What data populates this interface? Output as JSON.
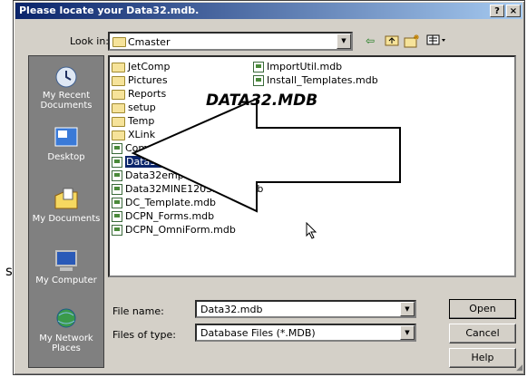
{
  "stray_text": "s",
  "dialog": {
    "title": "Please locate your Data32.mdb.",
    "help_button": "?",
    "close_button": "×"
  },
  "lookin": {
    "label": "Look in:",
    "value": "Cmaster"
  },
  "toolbar": {
    "back_icon": "back-arrow-icon",
    "up_icon": "up-folder-icon",
    "new_folder_icon": "new-folder-icon",
    "views_icon": "views-menu-icon"
  },
  "places": [
    {
      "label": "My Recent Documents",
      "icon": "recent-documents-icon"
    },
    {
      "label": "Desktop",
      "icon": "desktop-icon"
    },
    {
      "label": "My Documents",
      "icon": "my-documents-icon"
    },
    {
      "label": "My Computer",
      "icon": "my-computer-icon"
    },
    {
      "label": "My Network Places",
      "icon": "network-places-icon"
    }
  ],
  "files": [
    {
      "name": "JetComp",
      "type": "folder"
    },
    {
      "name": "Pictures",
      "type": "folder"
    },
    {
      "name": "Reports",
      "type": "folder"
    },
    {
      "name": "setup",
      "type": "folder"
    },
    {
      "name": "Temp",
      "type": "folder"
    },
    {
      "name": "XLink",
      "type": "folder"
    },
    {
      "name": "Compact.mdb",
      "type": "mdb"
    },
    {
      "name": "Data32.mdb",
      "type": "mdb",
      "selected": true
    },
    {
      "name": "Data32empty.mdb",
      "type": "mdb"
    },
    {
      "name": "Data32MINE12032005.mdb",
      "type": "mdb"
    },
    {
      "name": "DC_Template.mdb",
      "type": "mdb"
    },
    {
      "name": "DCPN_Forms.mdb",
      "type": "mdb"
    },
    {
      "name": "DCPN_OmniForm.mdb",
      "type": "mdb"
    },
    {
      "name": "ImportUtil.mdb",
      "type": "mdb"
    },
    {
      "name": "Install_Templates.mdb",
      "type": "mdb"
    }
  ],
  "callout": "DATA32.MDB",
  "filename": {
    "label": "File name:",
    "value": "Data32.mdb"
  },
  "filetype": {
    "label": "Files of type:",
    "value": "Database Files (*.MDB)"
  },
  "buttons": {
    "open": "Open",
    "cancel": "Cancel",
    "help": "Help"
  }
}
